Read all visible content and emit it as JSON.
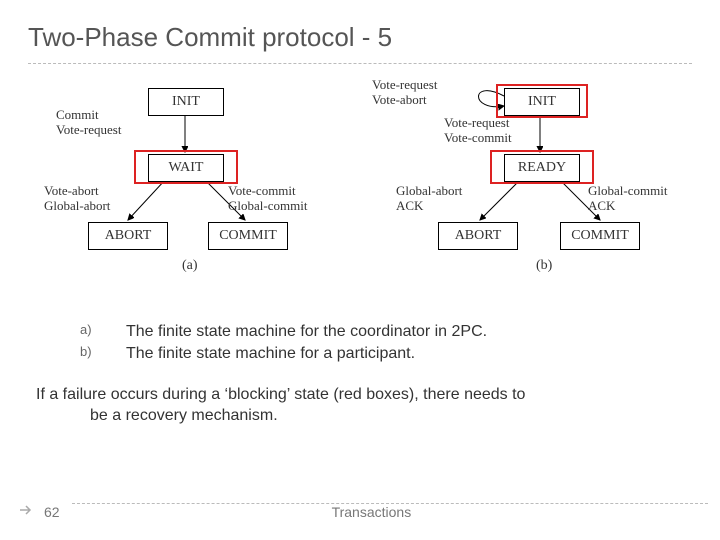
{
  "title": "Two-Phase Commit protocol - 5",
  "diagram_a": {
    "states": {
      "init": "INIT",
      "wait": "WAIT",
      "abort": "ABORT",
      "commit": "COMMIT"
    },
    "labels": {
      "commit_voterequest": "Commit\nVote-request",
      "voteabort_globalabort": "Vote-abort\nGlobal-abort",
      "votecommit_globalcommit": "Vote-commit\nGlobal-commit"
    },
    "caption": "(a)"
  },
  "diagram_b": {
    "states": {
      "init": "INIT",
      "ready": "READY",
      "abort": "ABORT",
      "commit": "COMMIT"
    },
    "labels": {
      "voterequest_voteabort": "Vote-request\nVote-abort",
      "voterequest_votecommit": "Vote-request\nVote-commit",
      "globalabort_ack": "Global-abort\nACK",
      "globalcommit_ack": "Global-commit\nACK"
    },
    "caption": "(b)"
  },
  "list": {
    "a_letter": "a)",
    "a_text": "The finite state machine for the coordinator in 2PC.",
    "b_letter": "b)",
    "b_text": "The finite state machine for a participant."
  },
  "recovery": {
    "line1": "If a failure occurs during a ‘blocking’ state (red boxes), there needs to",
    "line2": "be a recovery mechanism."
  },
  "footer": {
    "page": "62",
    "label": "Transactions"
  }
}
